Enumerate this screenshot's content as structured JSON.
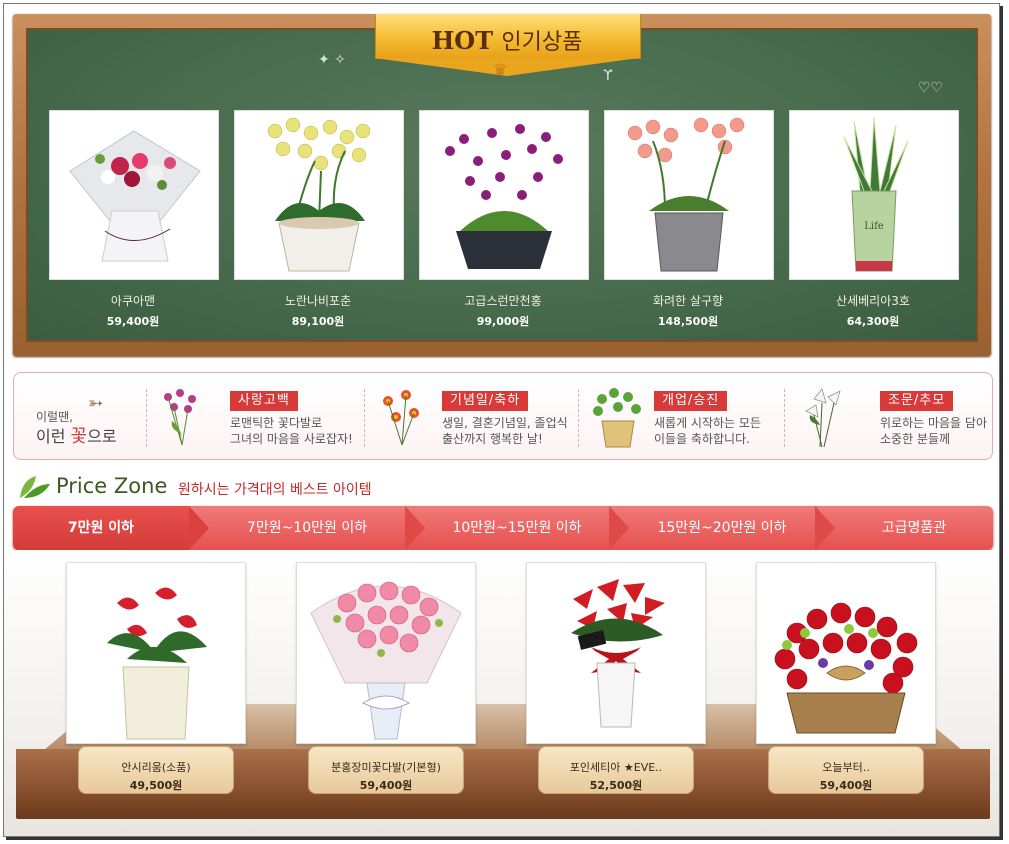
{
  "hot": {
    "title_en": "HOT",
    "title_ko": "인기상품",
    "items": [
      {
        "name": "아쿠아맨",
        "price": "59,400원",
        "icon": "bouquet-white-red"
      },
      {
        "name": "노란나비포춘",
        "price": "89,100원",
        "icon": "yellow-orchid-pot"
      },
      {
        "name": "고급스런만천홍",
        "price": "99,000원",
        "icon": "purple-orchid-pot"
      },
      {
        "name": "화려한 살구향",
        "price": "148,500원",
        "icon": "pink-orchid-pot"
      },
      {
        "name": "산세베리아3호",
        "price": "64,300원",
        "icon": "sansevieria-pot"
      }
    ]
  },
  "categories": {
    "intro_line1": "이럴땐,",
    "intro_line2": "이런",
    "intro_flower": "꽃",
    "intro_suffix": "으로",
    "items": [
      {
        "tag": "사랑고백",
        "line1": "로맨틱한 꽃다발로",
        "line2": "그녀의 마음을 사로잡자!",
        "icon": "love-flowers-icon"
      },
      {
        "tag": "기념일/축하",
        "line1": "생일, 결혼기념일, 졸업식",
        "line2": "출산까지 행복한 날!",
        "icon": "celebration-flowers-icon"
      },
      {
        "tag": "개업/승진",
        "line1": "새롭게 시작하는 모든",
        "line2": "이들을 축하합니다.",
        "icon": "potted-plant-icon"
      },
      {
        "tag": "조문/추모",
        "line1": "위로하는 마음을 담아",
        "line2": "소중한 분들께",
        "icon": "white-lily-icon"
      }
    ]
  },
  "price_zone": {
    "title": "Price Zone",
    "subtitle": "원하시는 가격대의 베스트 아이템",
    "tabs": [
      "7만원 이하",
      "7만원~10만원 이하",
      "10만원~15만원 이하",
      "15만원~20만원 이하",
      "고급명품관"
    ],
    "active_tab": 0,
    "items": [
      {
        "name": "안시리움(소품)",
        "price": "49,500원",
        "icon": "anthurium-pot"
      },
      {
        "name": "분홍장미꽃다발(기본형)",
        "price": "59,400원",
        "icon": "pink-rose-bouquet"
      },
      {
        "name": "포인세티아 ★EVE..",
        "price": "52,500원",
        "icon": "poinsettia-pot"
      },
      {
        "name": "오늘부터..",
        "price": "59,400원",
        "icon": "red-rose-basket"
      }
    ]
  },
  "colors": {
    "board_green": "#466a4b",
    "wood": "#b0733f",
    "accent_red": "#d83a3a",
    "tab_red": "#e5514f"
  }
}
